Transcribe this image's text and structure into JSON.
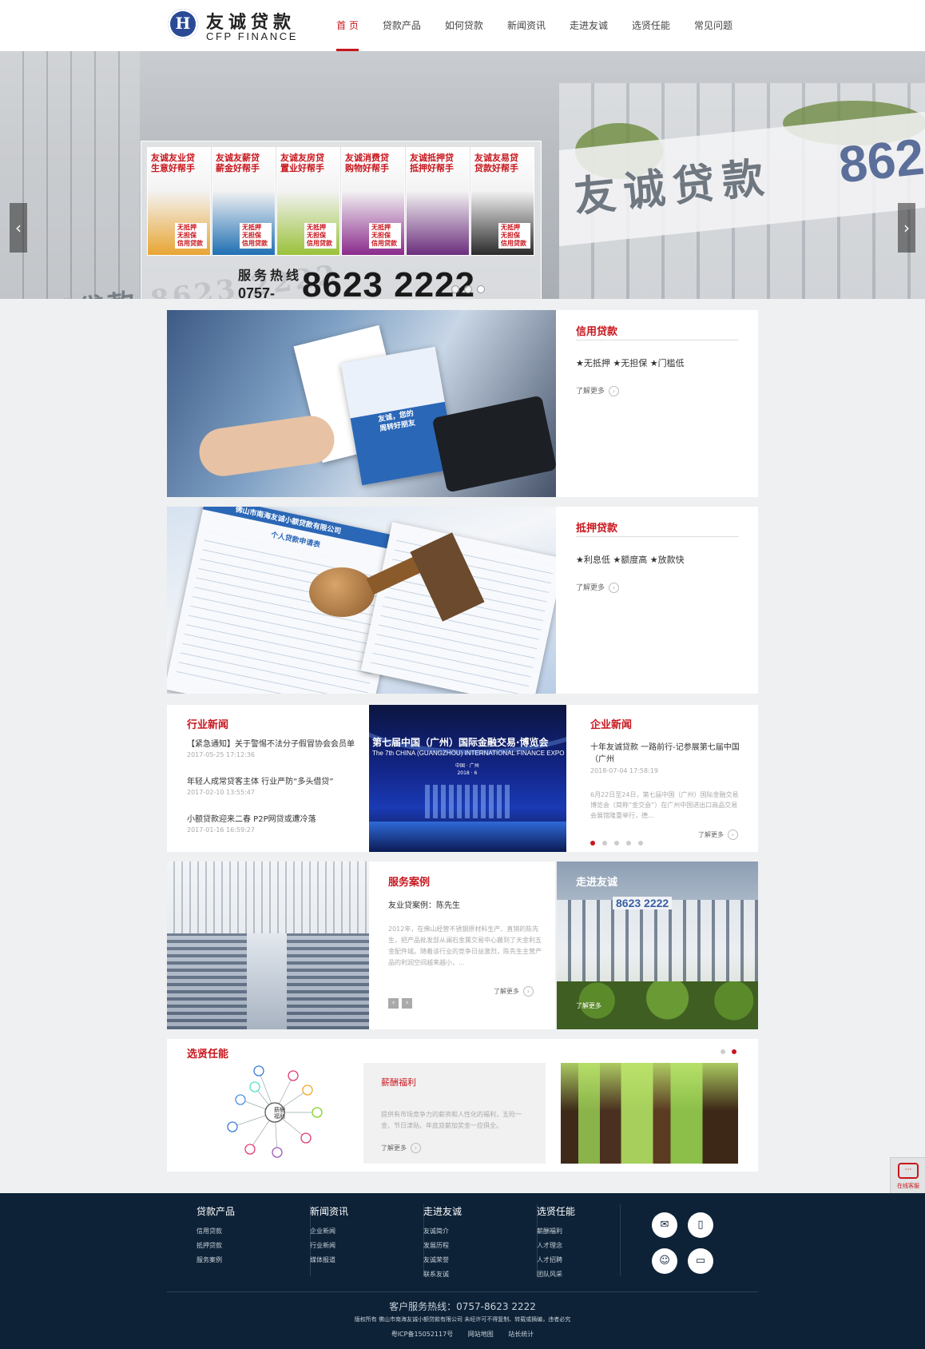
{
  "header": {
    "logo_cn": "友诚贷款",
    "logo_en": "CFP FINANCE",
    "nav": [
      "首 页",
      "贷款产品",
      "如何贷款",
      "新闻资讯",
      "走进友诚",
      "选贤任能",
      "常见问题"
    ],
    "active_index": 0
  },
  "banner": {
    "building_sign": "友诚贷款",
    "building_num": "862",
    "lower_sign": "友诚贷款 8623 2222",
    "posters": [
      {
        "title": "友诚友业贷\n生意好帮手",
        "tag": "无抵押 无担保 信用贷款",
        "color": "#e8a533"
      },
      {
        "title": "友诚友薪贷\n薪金好帮手",
        "tag": "无抵押 无担保 信用贷款",
        "color": "#1f6fb3"
      },
      {
        "title": "友诚友房贷\n置业好帮手",
        "tag": "无抵押 无担保 信用贷款",
        "color": "#9ac13a"
      },
      {
        "title": "友诚消费贷\n购物好帮手",
        "tag": "无抵押 无担保 信用贷款",
        "color": "#8a2a8c"
      },
      {
        "title": "友诚抵押贷\n抵押好帮手",
        "tag": "",
        "color": "#6b2e7c"
      },
      {
        "title": "友诚友易贷\n贷款好帮手",
        "tag": "无抵押 无担保 信用贷款",
        "color": "#2a2a2a"
      }
    ],
    "hotline_label": "服务热线",
    "hotline_area": "0757-",
    "hotline_number": "8623 2222",
    "slide_count": 3,
    "slide_active": 2
  },
  "products": [
    {
      "title": "信用贷款",
      "features": "★无抵押 ★无担保 ★门槛低",
      "more": "了解更多",
      "brochure": "友诚，您的\n周转好朋友"
    },
    {
      "title": "抵押贷款",
      "features": "★利息低 ★额度高 ★放款快",
      "more": "了解更多",
      "form_title": "佛山市南海友诚小额贷款有限公司",
      "form_sub": "个人贷款申请表"
    }
  ],
  "industry_news": {
    "title": "行业新闻",
    "items": [
      {
        "text": "【紧急通知】关于警惕不法分子假冒协会会员单",
        "date": "2017-05-25 17:12:36"
      },
      {
        "text": "年轻人成常贷客主体 行业严防“多头借贷”",
        "date": "2017-02-10 13:55:47"
      },
      {
        "text": "小额贷款迎来二春 P2P网贷或遭冷落",
        "date": "2017-01-16 16:59:27"
      }
    ]
  },
  "expo": {
    "title_cn": "第七届中国（广州）国际金融交易·博览会",
    "title_en": "The 7th CHINA (GUANGZHOU) INTERNATIONAL FINANCE EXPO",
    "place": "中国 · 广州\n2018 · 6"
  },
  "company_news": {
    "title": "企业新闻",
    "headline": "十年友诚贷款 一路前行-记参展第七届中国（广州",
    "date": "2018-07-04 17:58:19",
    "desc": "6月22日至24日，第七届中国（广州）国际金融交易博览会（简称“金交会”）在广州中国进出口商品交易会展馆隆重举行，德...",
    "more": "了解更多",
    "dot_count": 5,
    "dot_active": 0
  },
  "service_case": {
    "title": "服务案例",
    "subtitle": "友业贷案例：陈先生",
    "desc": "2012年，在佛山经营不锈钢原材料生产、直销的陈先生，把产品批发部从澜石金属交易中心搬到了天金利五金配件城。随着该行业的竞争日益激烈，陈先生主营产品的利润空间越来越小，...",
    "more": "了解更多",
    "prev": "‹",
    "next": "›"
  },
  "about": {
    "title": "走进友诚",
    "sign": "8623 2222",
    "more": "了解更多"
  },
  "talent": {
    "title": "选贤任能",
    "benefit_title": "薪酬福利",
    "benefit_desc": "提供有市场竞争力的薪资和人性化的福利，五险一金、节日津贴、年底双薪加奖金一应俱全。",
    "more": "了解更多",
    "mindmap_center": "薪酬\n福利",
    "dot_count": 2,
    "dot_active": 1
  },
  "side_service": {
    "label": "在线客服"
  },
  "footer": {
    "columns": [
      {
        "title": "贷款产品",
        "items": [
          "信用贷款",
          "抵押贷款",
          "服务案例"
        ]
      },
      {
        "title": "新闻资讯",
        "items": [
          "企业新闻",
          "行业新闻",
          "媒体报道"
        ]
      },
      {
        "title": "走进友诚",
        "items": [
          "友诚简介",
          "发展历程",
          "友诚荣誉",
          "联系友诚"
        ]
      },
      {
        "title": "选贤任能",
        "items": [
          "薪酬福利",
          "人才理念",
          "人才招聘",
          "团队风采"
        ]
      }
    ],
    "icons": [
      "wechat-icon",
      "mobile-icon",
      "qq-icon",
      "monitor-icon"
    ],
    "hotline": "客户服务热线：0757-8623 2222",
    "copyright": "版权所有 佛山市南海友诚小额贷款有限公司 未经许可不得复制、转载或摘编，违者必究",
    "icp": "粤ICP备15052117号",
    "sitemap": "网站地图",
    "stats": "站长统计"
  },
  "colors": {
    "accent": "#c8161d",
    "footer_bg": "#0d2237",
    "brand_blue": "#2a4a96"
  }
}
